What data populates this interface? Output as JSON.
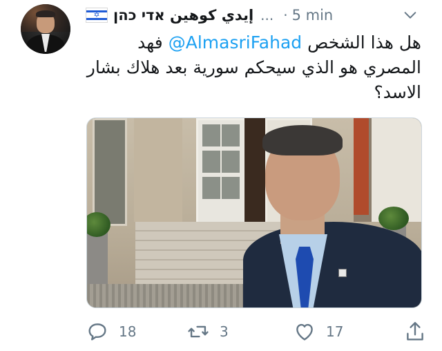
{
  "tweet": {
    "display_name": "إيدي كوهين אדי כהן",
    "ellipsis": "...",
    "separator": "·",
    "time": "5 min",
    "text_part1": "هل هذا الشخص",
    "mention": "@AlmasriFahad",
    "text_part2": "فهد المصري هو الذي سيحكم سورية بعد هلاك بشار الاسد؟"
  },
  "icons": {
    "avatar": "profile-photo",
    "flag": "israel-flag-icon",
    "more": "chevron-down-icon",
    "reply": "reply-icon",
    "retweet": "retweet-icon",
    "like": "heart-icon",
    "share": "share-icon"
  },
  "actions": {
    "replies": "18",
    "retweets": "3",
    "likes": "17"
  },
  "colors": {
    "text": "#14171a",
    "secondary": "#657786",
    "link": "#1da1f2",
    "flag_blue": "#1f5bd6"
  }
}
